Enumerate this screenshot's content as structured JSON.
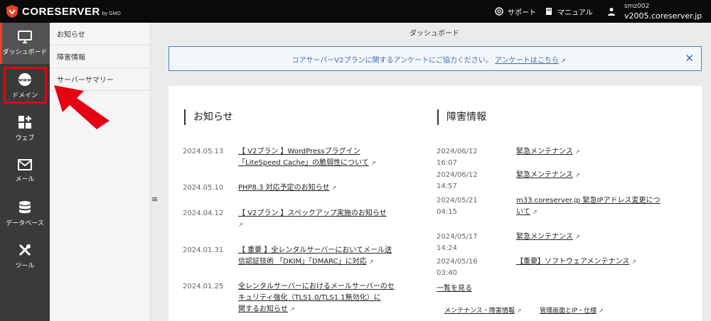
{
  "header": {
    "logo_text": "CORESERVER",
    "logo_sub": "by GMO",
    "support_label": "サポート",
    "manual_label": "マニュアル",
    "user_name": "smz002",
    "user_host": "v2005.coreserver.jp"
  },
  "sidebar": {
    "items": [
      {
        "label": "ダッシュボード",
        "icon": "monitor-icon"
      },
      {
        "label": "ドメイン",
        "icon": "www-globe-icon"
      },
      {
        "label": "ウェブ",
        "icon": "grid-plus-icon"
      },
      {
        "label": "メール",
        "icon": "envelope-icon"
      },
      {
        "label": "データベース",
        "icon": "database-icon"
      },
      {
        "label": "ツール",
        "icon": "tools-icon"
      }
    ]
  },
  "submenu": {
    "items": [
      "お知らせ",
      "障害情報",
      "サーバーサマリー"
    ]
  },
  "main": {
    "title": "ダッシュボード",
    "notice_text": "コアサーバーV2プランに関するアンケートにご協力ください。",
    "notice_link": "アンケートはこちら",
    "notice_close": "✕"
  },
  "news": {
    "heading": "お知らせ",
    "items": [
      {
        "date": "2024.05.13",
        "line1": "【 V2プラン 】WordPressプラグイン",
        "line2": "「LiteSpeed Cache」の脆弱性について"
      },
      {
        "date": "2024.05.10",
        "line1": "PHP8.3 対応予定のお知らせ",
        "line2": ""
      },
      {
        "date": "2024.04.12",
        "line1": "【 V2プラン 】スペックアップ実施のお知らせ",
        "line2": ""
      },
      {
        "date": "2024.01.31",
        "line1": "【 重要 】全レンタルサーバーにおいてメール送",
        "line2": "信認証技術 「DKIM」「DMARC」に対応"
      },
      {
        "date": "2024.01.25",
        "line1": "全レンタルサーバーにおけるメールサーバーのセ",
        "line2": "キュリティ強化（TLS1.0/TLS1.1無効化）に",
        "line3": "関するお知らせ"
      }
    ]
  },
  "incidents": {
    "heading": "障害情報",
    "items": [
      {
        "date": "2024/06/12 16:07",
        "line1": "緊急メンテナンス",
        "line2": ""
      },
      {
        "date": "2024/06/12 14:57",
        "line1": "緊急メンテナンス",
        "line2": ""
      },
      {
        "date": "2024/05/21 04:15",
        "line1": "m33.coreserver.jp 緊急IPアドレス変更につ",
        "line2": "いて"
      },
      {
        "date": "2024/05/17 14:24",
        "line1": "緊急メンテナンス",
        "line2": ""
      },
      {
        "date": "2024/05/16 03:40",
        "line1": "【重要】ソフトウェアメンテナンス",
        "line2": ""
      }
    ],
    "more_label": "一覧を見る",
    "footer_links": [
      "メンテナンス・障害情報",
      "管理画面とIP・仕様"
    ]
  },
  "colors": {
    "header_bg": "#0a0a0a",
    "sidebar_bg": "#3a3a3a",
    "accent": "#e8421f",
    "notice_blue": "#3f6db3",
    "highlight_red": "#e60012"
  }
}
